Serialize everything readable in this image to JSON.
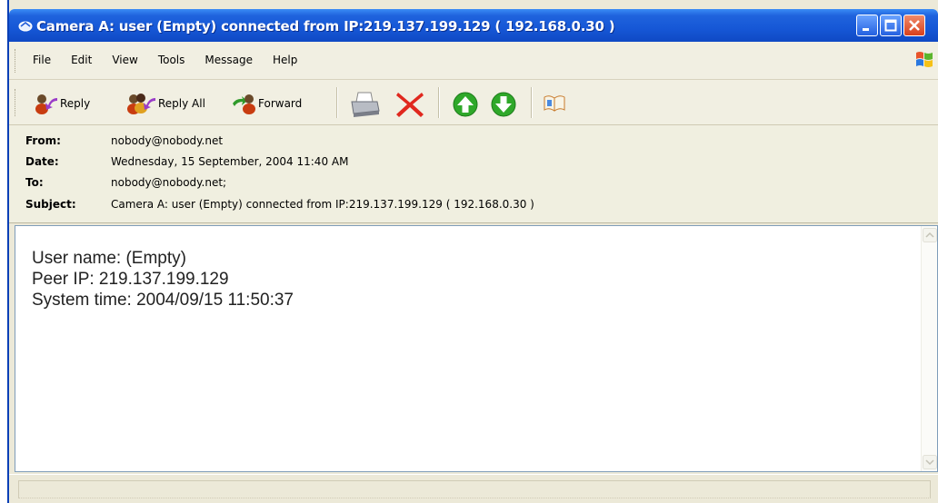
{
  "window": {
    "title": "Camera A: user (Empty) connected from IP:219.137.199.129 ( 192.168.0.30 )"
  },
  "menu": {
    "items": [
      "File",
      "Edit",
      "View",
      "Tools",
      "Message",
      "Help"
    ]
  },
  "toolbar": {
    "reply": "Reply",
    "reply_all": "Reply All",
    "forward": "Forward"
  },
  "headers": {
    "from_label": "From:",
    "from": "nobody@nobody.net",
    "date_label": "Date:",
    "date": "Wednesday, 15 September, 2004 11:40 AM",
    "to_label": "To:",
    "to": "nobody@nobody.net;",
    "subject_label": "Subject:",
    "subject": "Camera A: user (Empty) connected from IP:219.137.199.129 ( 192.168.0.30 )"
  },
  "message": {
    "lines": [
      "User name: (Empty)",
      "Peer IP: 219.137.199.129",
      "System time: 2004/09/15 11:50:37"
    ]
  },
  "colors": {
    "titlebar": "#1657d6",
    "chrome": "#ece9d8",
    "delete_red": "#e0281e",
    "nav_green": "#2fa82a"
  }
}
